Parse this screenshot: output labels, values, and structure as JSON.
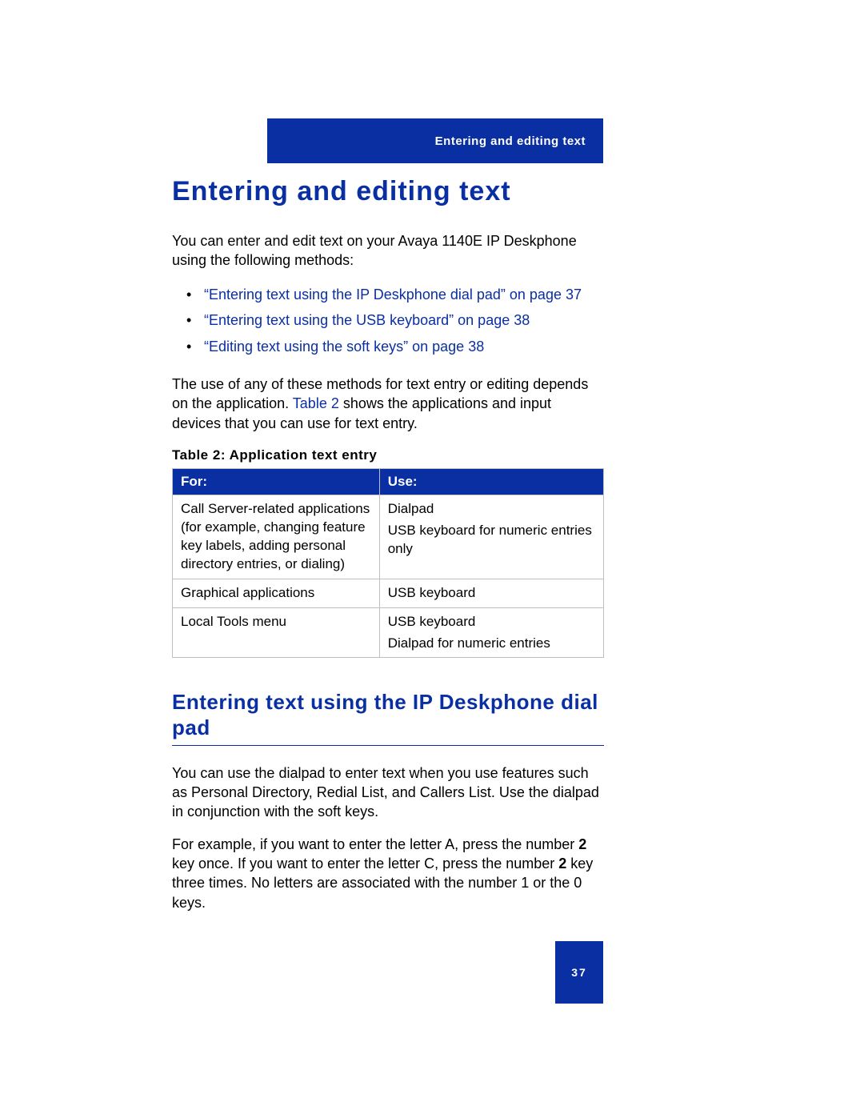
{
  "header": {
    "running_title": "Entering and editing text"
  },
  "h1": "Entering and editing text",
  "intro": "You can enter and edit text on your Avaya 1140E IP Deskphone using the following methods:",
  "links": [
    "“Entering text using the IP Deskphone dial pad” on page 37",
    "“Entering text using the USB keyboard” on page 38",
    "“Editing text using the soft keys” on page 38"
  ],
  "para2_a": "The use of any of these methods for text entry or editing depends on the application. ",
  "para2_link": "Table 2",
  "para2_b": " shows the applications and input devices that you can use for text entry.",
  "table_caption": "Table 2: Application text entry",
  "table": {
    "headers": {
      "c1": "For:",
      "c2": "Use:"
    },
    "rows": [
      {
        "c1": "Call Server-related applications (for example, changing feature key labels, adding personal directory entries, or dialing)",
        "c2a": "Dialpad",
        "c2b": "USB keyboard for numeric entries only"
      },
      {
        "c1": "Graphical applications",
        "c2a": "USB keyboard",
        "c2b": ""
      },
      {
        "c1": "Local Tools menu",
        "c2a": "USB keyboard",
        "c2b": "Dialpad for numeric entries"
      }
    ]
  },
  "h2": "Entering text using the IP Deskphone dial pad",
  "p3": "You can use the dialpad to enter text when you use features such as Personal Directory, Redial List, and Callers List. Use the dialpad in conjunction with the soft keys.",
  "p4_a": "For example, if you want to enter the letter A, press the number ",
  "p4_b": "2",
  "p4_c": " key once. If you want to enter the letter C, press the number ",
  "p4_d": "2",
  "p4_e": " key three times. No letters are associated with the number 1 or the 0 keys.",
  "page_number": "37"
}
